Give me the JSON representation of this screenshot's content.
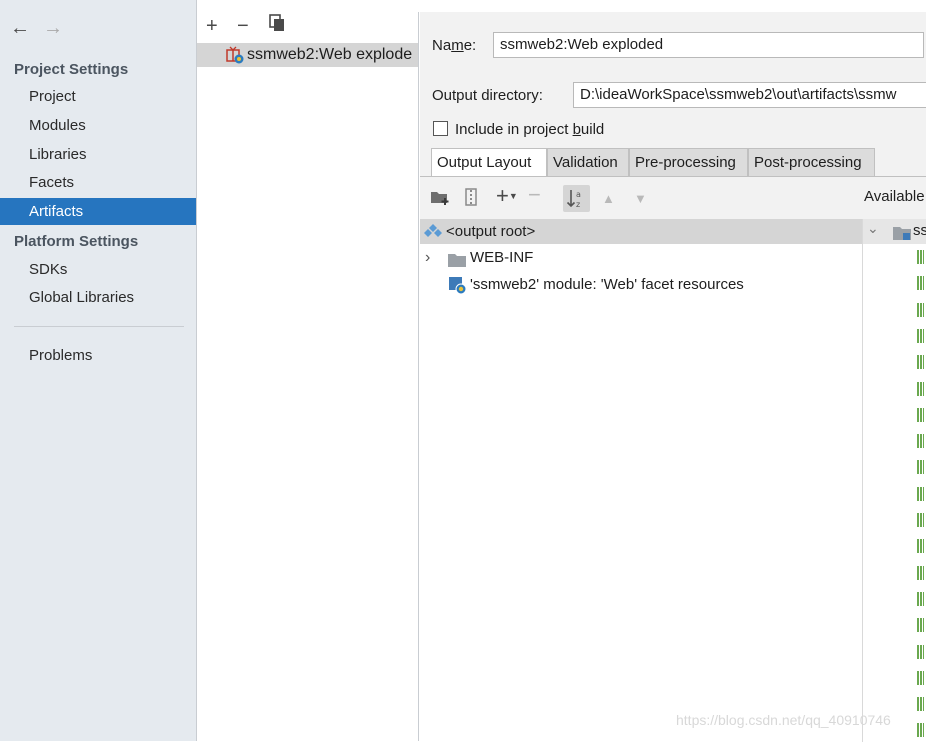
{
  "sidebar": {
    "back_icon": "arrow-left-icon",
    "forward_icon": "arrow-right-icon",
    "project_settings_heading": "Project Settings",
    "project_items": [
      {
        "label": "Project"
      },
      {
        "label": "Modules"
      },
      {
        "label": "Libraries"
      },
      {
        "label": "Facets"
      },
      {
        "label": "Artifacts",
        "selected": true
      }
    ],
    "platform_settings_heading": "Platform Settings",
    "platform_items": [
      {
        "label": "SDKs"
      },
      {
        "label": "Global Libraries"
      }
    ],
    "problems_label": "Problems"
  },
  "artifacts": {
    "toolbar": [
      "plus-icon",
      "minus-icon",
      "copy-icon"
    ],
    "items": [
      {
        "label": "ssmweb2:Web explode",
        "icon": "web-artifact-icon",
        "selected": true
      }
    ]
  },
  "config": {
    "name_label_pre": "Na",
    "name_label_u": "m",
    "name_label_post": "e:",
    "name_value": "ssmweb2:Web exploded",
    "output_dir_label": "Output directory:",
    "output_dir_value": "D:\\ideaWorkSpace\\ssmweb2\\out\\artifacts\\ssmw",
    "include_label_pre": "Include in project ",
    "include_label_u": "b",
    "include_label_post": "uild",
    "include_checked": false
  },
  "tabs": [
    {
      "label": "Output Layout",
      "active": true
    },
    {
      "label": "Validation"
    },
    {
      "label": "Pre-processing"
    },
    {
      "label": "Post-processing"
    }
  ],
  "layout_toolbar": [
    "new-folder-icon",
    "archive-icon",
    "add-icon",
    "remove-icon",
    "sort-icon",
    "move-up-icon",
    "move-down-icon"
  ],
  "tree": {
    "root_label": "<output root>",
    "children": [
      {
        "label": "WEB-INF",
        "icon": "folder-icon",
        "expandable": true
      },
      {
        "label": "'ssmweb2' module: 'Web' facet resources",
        "icon": "web-facet-icon"
      }
    ]
  },
  "available": {
    "header": "Available",
    "first_item": "ss"
  },
  "watermark": "https://blog.csdn.net/qq_40910746",
  "colors": {
    "accent": "#2675bf",
    "sidebar_bg": "#e5eaef",
    "pane_bg": "#f2f2f2",
    "selected_row": "#d5d5d5"
  }
}
